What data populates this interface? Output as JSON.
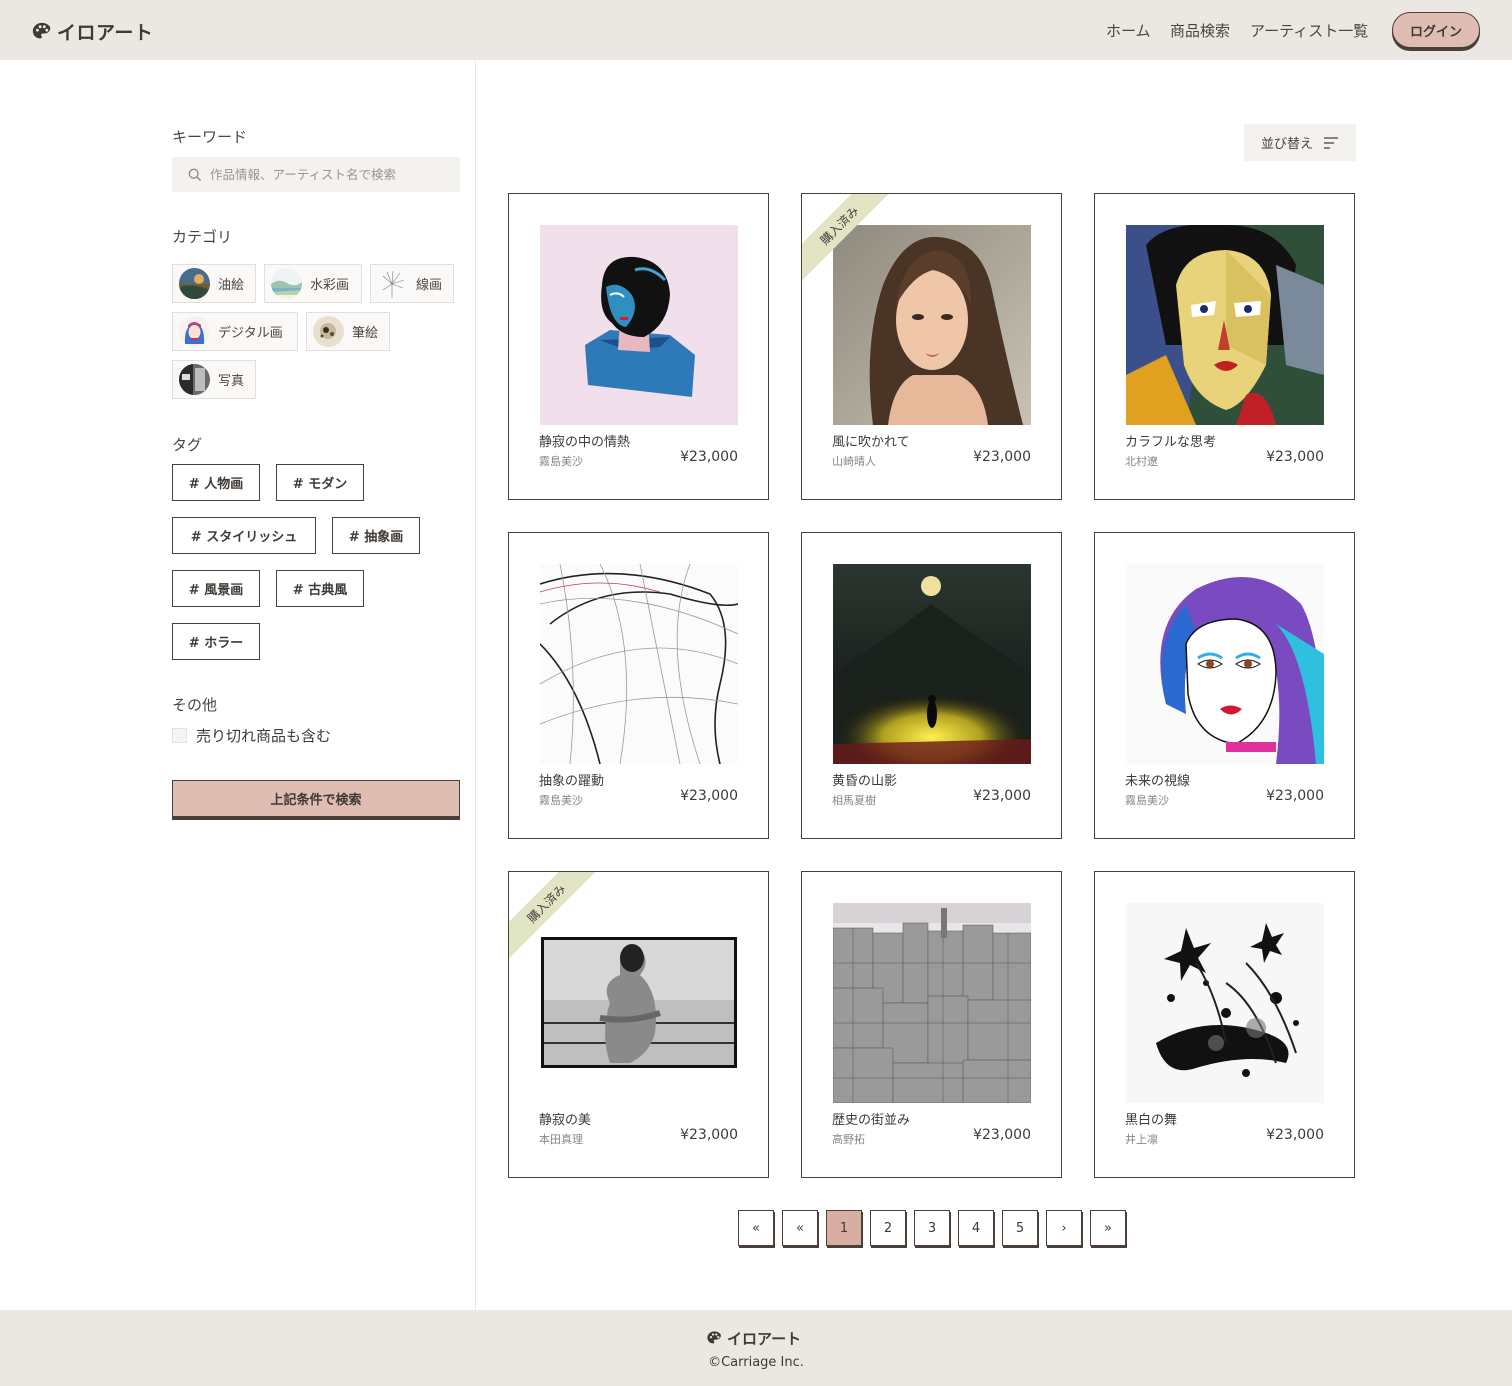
{
  "header": {
    "logo_text": "イロアート",
    "nav": [
      "ホーム",
      "商品検索",
      "アーティスト一覧"
    ],
    "login_label": "ログイン"
  },
  "sidebar": {
    "keyword_heading": "キーワード",
    "search_placeholder": "作品情報、アーティスト名で検索",
    "category_heading": "カテゴリ",
    "categories": [
      "油絵",
      "水彩画",
      "線画",
      "デジタル画",
      "筆絵",
      "写真"
    ],
    "tag_heading": "タグ",
    "tags": [
      "# 人物画",
      "# モダン",
      "# スタイリッシュ",
      "# 抽象画",
      "# 風景画",
      "# 古典風",
      "# ホラー"
    ],
    "other_heading": "その他",
    "sold_out_label": "売り切れ商品も含む",
    "search_button": "上記条件で検索"
  },
  "sort_label": "並び替え",
  "purchased_label": "購入済み",
  "products": [
    {
      "title": "静寂の中の情熱",
      "artist": "霧島美沙",
      "price": "¥23,000",
      "purchased": false
    },
    {
      "title": "風に吹かれて",
      "artist": "山崎晴人",
      "price": "¥23,000",
      "purchased": true
    },
    {
      "title": "カラフルな思考",
      "artist": "北村遼",
      "price": "¥23,000",
      "purchased": false
    },
    {
      "title": "抽象の躍動",
      "artist": "霧島美沙",
      "price": "¥23,000",
      "purchased": false
    },
    {
      "title": "黄昏の山影",
      "artist": "相馬夏樹",
      "price": "¥23,000",
      "purchased": false
    },
    {
      "title": "未来の視線",
      "artist": "霧島美沙",
      "price": "¥23,000",
      "purchased": false
    },
    {
      "title": "静寂の美",
      "artist": "本田真理",
      "price": "¥23,000",
      "purchased": true
    },
    {
      "title": "歴史の街並み",
      "artist": "高野拓",
      "price": "¥23,000",
      "purchased": false
    },
    {
      "title": "黒白の舞",
      "artist": "井上凛",
      "price": "¥23,000",
      "purchased": false
    }
  ],
  "pagination": [
    "«",
    "«",
    "1",
    "2",
    "3",
    "4",
    "5",
    "›",
    "»"
  ],
  "current_page": "1",
  "footer": {
    "logo_text": "イロアート",
    "copyright": "©Carriage Inc."
  }
}
